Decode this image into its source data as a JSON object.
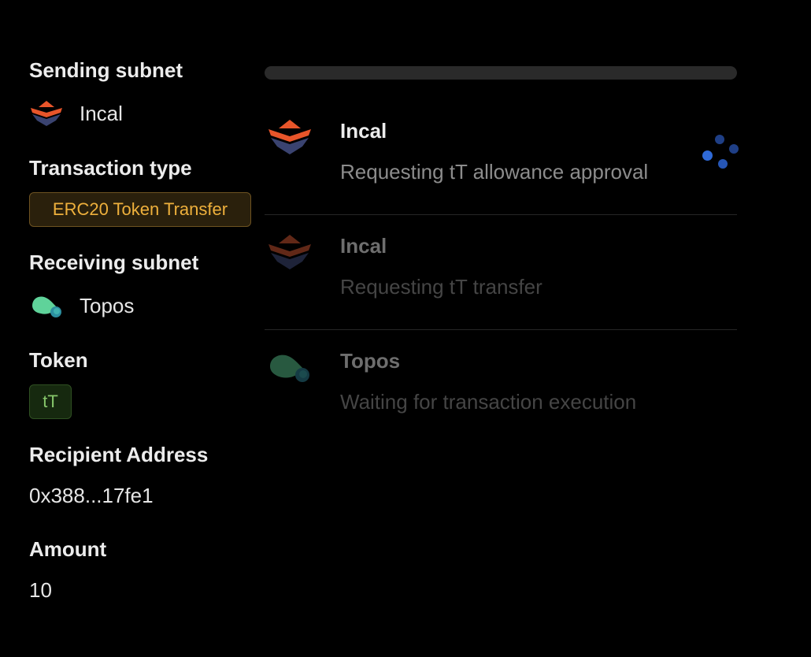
{
  "details": {
    "sending_subnet": {
      "label": "Sending subnet",
      "name": "Incal",
      "icon": "incal-logo-icon"
    },
    "transaction_type": {
      "label": "Transaction type",
      "value": "ERC20 Token Transfer"
    },
    "receiving_subnet": {
      "label": "Receiving subnet",
      "name": "Topos",
      "icon": "topos-logo-icon"
    },
    "token": {
      "label": "Token",
      "value": "tT"
    },
    "recipient": {
      "label": "Recipient Address",
      "value": "0x388...17fe1"
    },
    "amount": {
      "label": "Amount",
      "value": "10"
    }
  },
  "progress": {
    "fraction": 0.0
  },
  "steps": [
    {
      "title": "Incal",
      "description": "Requesting tT allowance approval",
      "state": "active",
      "icon": "incal-logo-icon"
    },
    {
      "title": "Incal",
      "description": "Requesting tT transfer",
      "state": "pending",
      "icon": "incal-logo-icon"
    },
    {
      "title": "Topos",
      "description": "Waiting for transaction execution",
      "state": "pending",
      "icon": "topos-logo-icon"
    }
  ],
  "colors": {
    "background": "#000000",
    "type_badge_text": "#eeb03c",
    "token_badge_text": "#86c66a",
    "spinner": "#2f6ad8",
    "incal_orange": "#e8552a",
    "incal_navy": "#3a4370",
    "topos_green": "#5fd39a"
  }
}
